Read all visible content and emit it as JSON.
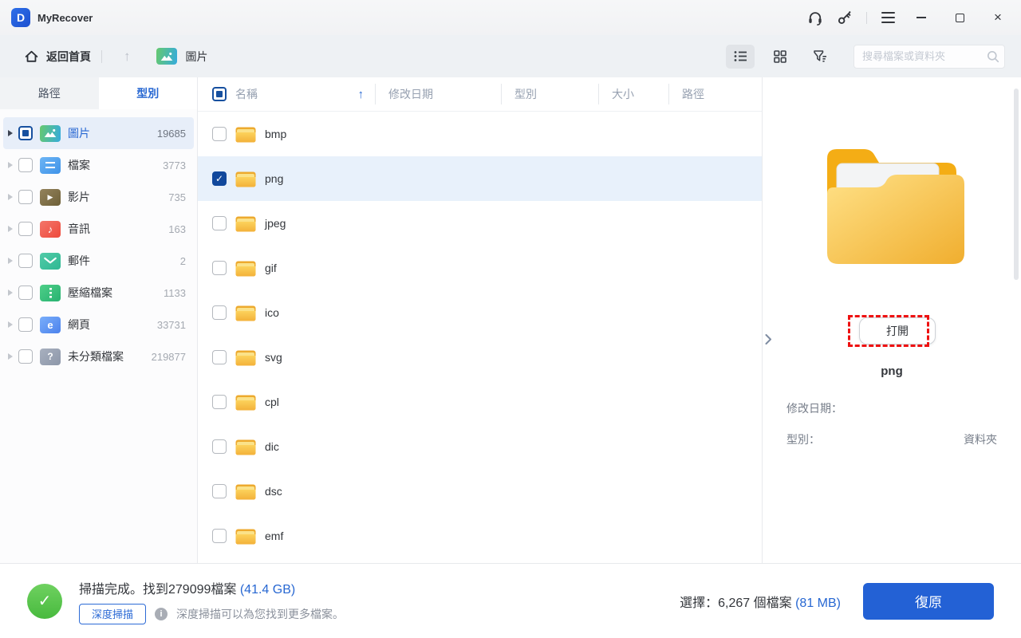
{
  "app": {
    "name": "MyRecover"
  },
  "icons": {
    "logo": "D",
    "check": "✓",
    "sort_up": "↑",
    "up_arrow": "↑",
    "close": "×",
    "play": "▶",
    "note": "♪",
    "browser": "e",
    "question": "?",
    "info": "i"
  },
  "toolbar": {
    "back_home": "返回首頁",
    "location": "圖片",
    "search_placeholder": "搜尋檔案或資料夾"
  },
  "sidebar": {
    "tabs": [
      {
        "label": "路徑",
        "active": false
      },
      {
        "label": "型別",
        "active": true
      }
    ],
    "items": [
      {
        "label": "圖片",
        "count": "19685",
        "icon": "pictures-folder-icon",
        "selected": true,
        "checkbox": "indeterminate"
      },
      {
        "label": "檔案",
        "count": "3773",
        "icon": "documents-folder-icon"
      },
      {
        "label": "影片",
        "count": "735",
        "icon": "videos-folder-icon"
      },
      {
        "label": "音訊",
        "count": "163",
        "icon": "audio-folder-icon"
      },
      {
        "label": "郵件",
        "count": "2",
        "icon": "mail-icon"
      },
      {
        "label": "壓縮檔案",
        "count": "1133",
        "icon": "archive-folder-icon"
      },
      {
        "label": "網頁",
        "count": "33731",
        "icon": "webpage-folder-icon"
      },
      {
        "label": "未分類檔案",
        "count": "219877",
        "icon": "unknown-folder-icon"
      }
    ]
  },
  "table": {
    "headers": {
      "name": "名稱",
      "date": "修改日期",
      "type": "型別",
      "size": "大小",
      "path": "路徑"
    },
    "sort": {
      "column": "名稱",
      "direction": "asc"
    },
    "rows": [
      {
        "name": "bmp",
        "checked": false,
        "selected": false
      },
      {
        "name": "png",
        "checked": true,
        "selected": true
      },
      {
        "name": "jpeg",
        "checked": false,
        "selected": false
      },
      {
        "name": "gif",
        "checked": false,
        "selected": false
      },
      {
        "name": "ico",
        "checked": false,
        "selected": false
      },
      {
        "name": "svg",
        "checked": false,
        "selected": false
      },
      {
        "name": "cpl",
        "checked": false,
        "selected": false
      },
      {
        "name": "dic",
        "checked": false,
        "selected": false
      },
      {
        "name": "dsc",
        "checked": false,
        "selected": false
      },
      {
        "name": "emf",
        "checked": false,
        "selected": false
      }
    ]
  },
  "preview": {
    "open_button": "打開",
    "file_name": "png",
    "fields": [
      {
        "label": "修改日期：",
        "value": ""
      },
      {
        "label": "型別：",
        "value": "資料夾"
      }
    ]
  },
  "status": {
    "scan_text": "掃描完成。找到279099檔案 ",
    "scan_size": "(41.4 GB)",
    "deep_scan": "深度掃描",
    "hint": "深度掃描可以為您找到更多檔案。",
    "selection": "選擇：6,267 個檔案 ",
    "selection_size": "(81 MB)",
    "recover": "復原"
  },
  "colors": {
    "accent_blue": "#2767d2",
    "recover_button": "#2361d5",
    "checkbox_navy": "#11489c",
    "selected_row": "#e8f1fb",
    "folder_yellow": "#f6b83c",
    "success_green": "#52c41a",
    "annotation_red": "#ee1111"
  }
}
